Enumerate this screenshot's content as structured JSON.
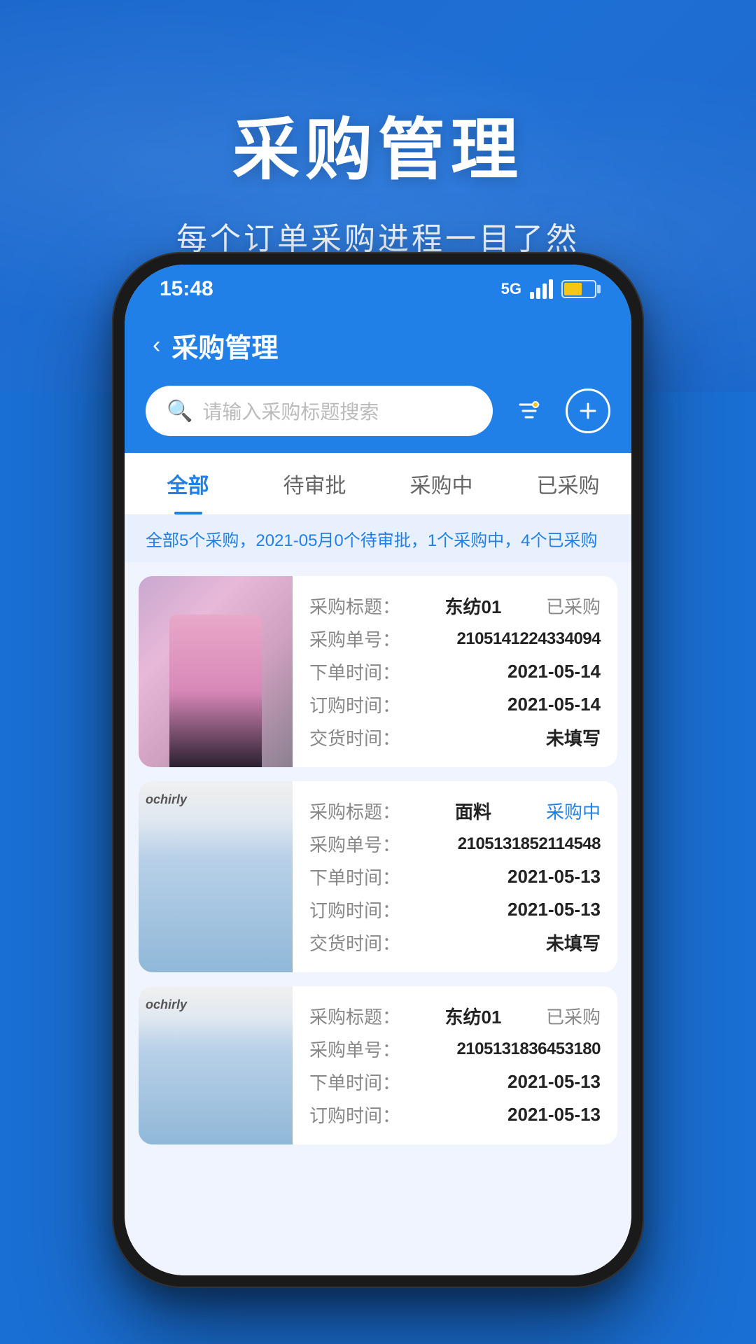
{
  "hero": {
    "title": "采购管理",
    "subtitle": "每个订单采购进程一目了然"
  },
  "status_bar": {
    "time": "15:48",
    "signal": "5G"
  },
  "header": {
    "back_label": "‹",
    "title": "采购管理"
  },
  "search": {
    "placeholder": "请输入采购标题搜索"
  },
  "tabs": [
    {
      "label": "全部",
      "active": true
    },
    {
      "label": "待审批",
      "active": false
    },
    {
      "label": "采购中",
      "active": false
    },
    {
      "label": "已采购",
      "active": false
    }
  ],
  "summary": {
    "text": "全部5个采购，2021-05月0个待审批，1个采购中，4个已采购"
  },
  "products": [
    {
      "image_type": "fashion1",
      "brand": "",
      "purchase_title_label": "采购标题：",
      "purchase_title": "东纺01",
      "status": "已采购",
      "status_type": "purchased",
      "order_no_label": "采购单号：",
      "order_no": "2105141224334094",
      "place_time_label": "下单时间：",
      "place_time": "2021-05-14",
      "order_time_label": "订购时间：",
      "order_time": "2021-05-14",
      "delivery_time_label": "交货时间：",
      "delivery_time": "未填写"
    },
    {
      "image_type": "fashion2",
      "brand": "ochirly",
      "purchase_title_label": "采购标题：",
      "purchase_title": "面料",
      "status": "采购中",
      "status_type": "purchasing",
      "order_no_label": "采购单号：",
      "order_no": "2105131852114548",
      "place_time_label": "下单时间：",
      "place_time": "2021-05-13",
      "order_time_label": "订购时间：",
      "order_time": "2021-05-13",
      "delivery_time_label": "交货时间：",
      "delivery_time": "未填写"
    },
    {
      "image_type": "fashion3",
      "brand": "ochirly",
      "purchase_title_label": "采购标题：",
      "purchase_title": "东纺01",
      "status": "已采购",
      "status_type": "purchased",
      "order_no_label": "采购单号：",
      "order_no": "2105131836453180",
      "place_time_label": "下单时间：",
      "place_time": "2021-05-13",
      "order_time_label": "订购时间：",
      "order_time": "2021-05-13",
      "delivery_time_label": "交货时间：",
      "delivery_time": ""
    }
  ],
  "colors": {
    "primary": "#2080e8",
    "purchased": "#888888",
    "purchasing": "#2080e8"
  }
}
